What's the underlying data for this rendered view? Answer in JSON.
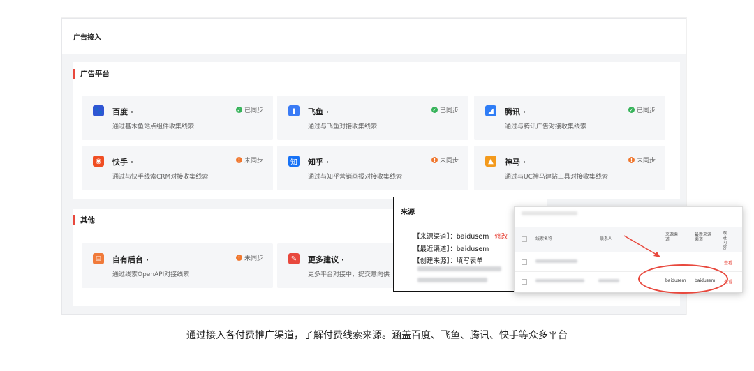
{
  "header": {
    "title": "广告接入"
  },
  "sections": {
    "platforms": {
      "title": "广告平台",
      "cards": [
        {
          "name": "百度 ·",
          "desc": "通过基木鱼站点组件收集线索",
          "status": "已同步",
          "synced": true,
          "icon": "baidu-paw-icon",
          "color": "#2f55d4"
        },
        {
          "name": "飞鱼 ·",
          "desc": "通过与飞鱼对接收集线索",
          "status": "已同步",
          "synced": true,
          "icon": "feiyu-bars-icon",
          "color": "#3a7bf5"
        },
        {
          "name": "腾讯 ·",
          "desc": "通过与腾讯广告对接收集线索",
          "status": "已同步",
          "synced": true,
          "icon": "tencent-icon",
          "color": "#2f7df6"
        },
        {
          "name": "快手 ·",
          "desc": "通过与快手线索CRM对接收集线索",
          "status": "未同步",
          "synced": false,
          "icon": "kuaishou-icon",
          "color": "#f04e23"
        },
        {
          "name": "知乎 ·",
          "desc": "通过与知乎营销画报对接收集线索",
          "status": "未同步",
          "synced": false,
          "icon": "zhihu-icon",
          "color": "#1772f6"
        },
        {
          "name": "神马 ·",
          "desc": "通过与UC神马建站工具对接收集线索",
          "status": "未同步",
          "synced": false,
          "icon": "shenma-icon",
          "color": "#f39a1d"
        }
      ]
    },
    "others": {
      "title": "其他",
      "cards": [
        {
          "name": "自有后台 ·",
          "desc": "通过线索OpenAPI对接线索",
          "status": "未同步",
          "synced": false,
          "icon": "api-icon",
          "color": "#f07a3a"
        },
        {
          "name": "更多建议 ·",
          "desc": "更多平台对接中，提交意向供",
          "icon": "suggest-icon",
          "color": "#e8483d"
        }
      ]
    }
  },
  "popup": {
    "title": "来源",
    "lines": [
      "【来源渠道】：baidusem",
      "【最近渠道】：baidusem",
      "【创建来源】：填写表单"
    ],
    "edit": "修改"
  },
  "table": {
    "headers": [
      "线索名称",
      "联系人",
      "来源渠道",
      "最新来源渠道",
      "跟进内容"
    ],
    "rows": [
      {
        "channel": "",
        "latest": "",
        "action": "查看"
      },
      {
        "channel": "baidusem",
        "latest": "baidusem",
        "action": "查看"
      }
    ]
  },
  "caption": "通过接入各付费推广渠道，了解付费线索来源。涵盖百度、飞鱼、腾讯、快手等众多平台"
}
